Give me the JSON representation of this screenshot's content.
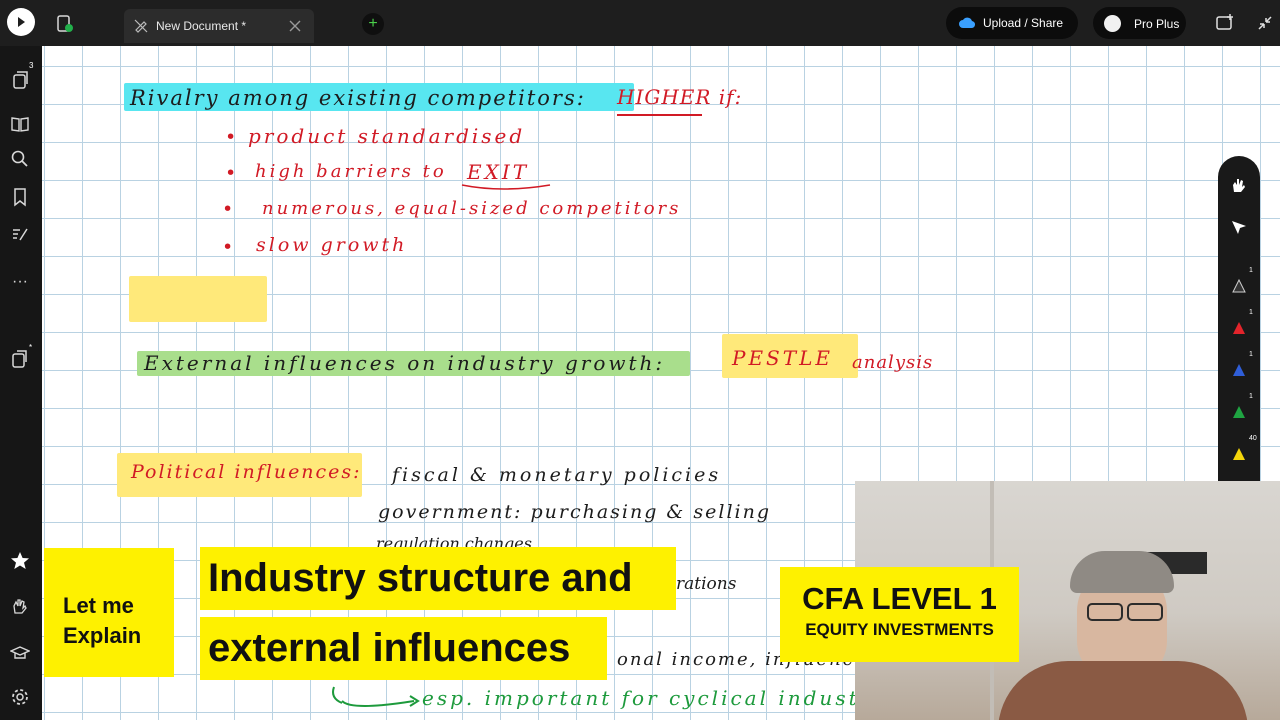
{
  "app": {
    "tab_title": "New Document *",
    "upload_label": "Upload / Share",
    "plan_label": "Pro Plus"
  },
  "sidebar": {
    "pages_badge": "3",
    "new_badge": "*"
  },
  "palette": {
    "counts": [
      "1",
      "1",
      "1",
      "1",
      "40"
    ]
  },
  "notes": {
    "heading_rivalry": "Rivalry among existing competitors:",
    "higher_if": "HIGHER if:",
    "bullets": [
      "product standardised",
      "high barriers to",
      "numerous, equal-sized competitors",
      "slow growth"
    ],
    "exit_word": "EXIT",
    "external_heading": "External influences on industry growth:",
    "pestle": "PESTLE",
    "pestle_suffix": "analysis",
    "political": "Political influences:",
    "fiscal_line": "fiscal & monetary policies",
    "gov_line": "government: purchasing & selling",
    "reg_line": "regulation changes",
    "trans_line": "rations",
    "income_line": "onal income, influences",
    "cyclical_line": "esp. important for cyclical industries"
  },
  "overlay": {
    "let_me": "Let me",
    "explain": "Explain",
    "title_line1": "Industry structure and",
    "title_line2": "external influences",
    "cfa_title": "CFA LEVEL 1",
    "cfa_subtitle": "EQUITY INVESTMENTS"
  },
  "colors": {
    "accent_yellow": "#fef100",
    "ink_black": "#1c1c1c",
    "ink_red": "#d11a25",
    "ink_green": "#1d9a3c",
    "highlight_cyan": "#58e6f0",
    "highlight_green": "#a9de8c",
    "highlight_yellow": "#ffe97a",
    "grid": "#b9d2e2"
  }
}
